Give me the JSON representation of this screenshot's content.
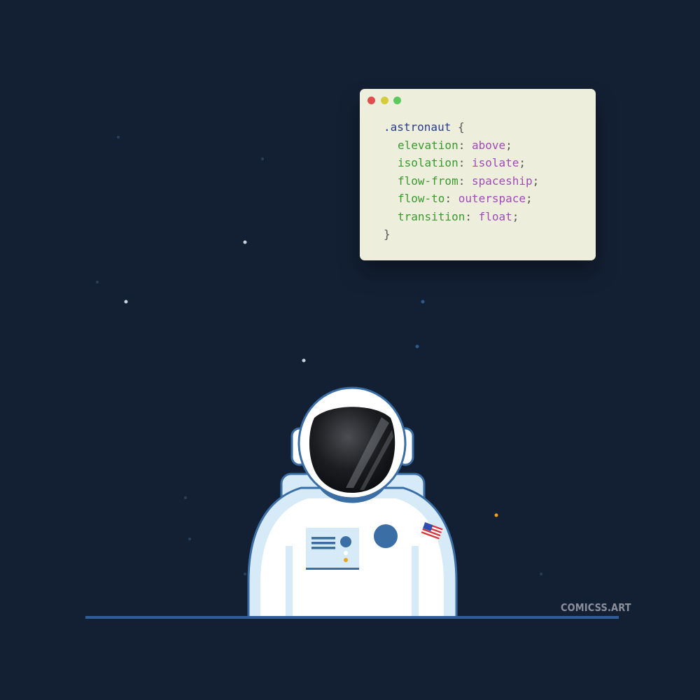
{
  "code": {
    "selector": ".astronaut",
    "open_brace": "{",
    "close_brace": "}",
    "declarations": [
      {
        "property": "elevation",
        "value": "above"
      },
      {
        "property": "isolation",
        "value": "isolate"
      },
      {
        "property": "flow-from",
        "value": "spaceship"
      },
      {
        "property": "flow-to",
        "value": "outerspace"
      },
      {
        "property": "transition",
        "value": "float"
      }
    ]
  },
  "credit": "COMICSS.ART",
  "colors": {
    "background": "#132034",
    "window": "#eeeedd",
    "suit": "#ffffff",
    "suit_trim": "#3a6ea5",
    "visor": "#0d0f12",
    "ground_line": "#2f5f96"
  },
  "icons": [
    "window-close-dot",
    "window-minimize-dot",
    "window-maximize-dot",
    "us-flag-patch"
  ]
}
